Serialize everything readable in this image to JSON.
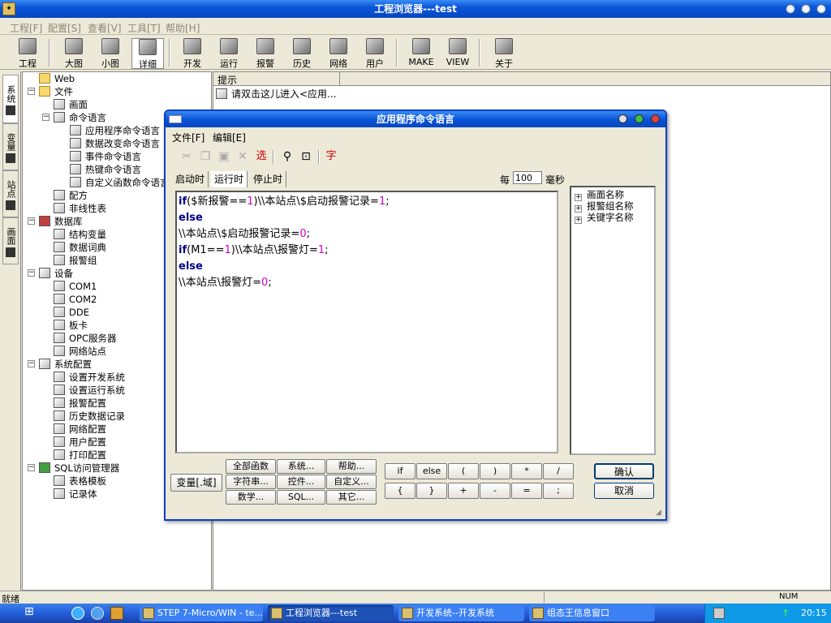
{
  "window": {
    "title": "工程浏览器---test"
  },
  "menubar": [
    "工程[F]",
    "配置[S]",
    "查看[V]",
    "工具[T]",
    "帮助[H]"
  ],
  "toolbar": [
    {
      "label": "工程",
      "icon": "project-icon"
    },
    {
      "label": "大图",
      "icon": "large-icons-icon"
    },
    {
      "label": "小图",
      "icon": "small-icons-icon"
    },
    {
      "label": "详细",
      "icon": "details-icon"
    },
    {
      "label": "开发",
      "icon": "develop-icon"
    },
    {
      "label": "运行",
      "icon": "run-icon"
    },
    {
      "label": "报警",
      "icon": "alarm-icon"
    },
    {
      "label": "历史",
      "icon": "history-icon"
    },
    {
      "label": "网络",
      "icon": "network-icon"
    },
    {
      "label": "用户",
      "icon": "user-key-icon"
    },
    {
      "label": "MAKE",
      "icon": "make-icon"
    },
    {
      "label": "VIEW",
      "icon": "view-icon"
    },
    {
      "label": "关于",
      "icon": "about-icon"
    }
  ],
  "side_tabs": [
    "系统",
    "变量",
    "站点",
    "画面"
  ],
  "tree": [
    {
      "label": "Web"
    },
    {
      "label": "文件"
    },
    {
      "label": "画面"
    },
    {
      "label": "命令语言"
    },
    {
      "label": "应用程序命令语言"
    },
    {
      "label": "数据改变命令语言"
    },
    {
      "label": "事件命令语言"
    },
    {
      "label": "热键命令语言"
    },
    {
      "label": "自定义函数命令语言"
    },
    {
      "label": "配方"
    },
    {
      "label": "非线性表"
    },
    {
      "label": "数据库"
    },
    {
      "label": "结构变量"
    },
    {
      "label": "数据词典"
    },
    {
      "label": "报警组"
    },
    {
      "label": "设备"
    },
    {
      "label": "COM1"
    },
    {
      "label": "COM2"
    },
    {
      "label": "DDE"
    },
    {
      "label": "板卡"
    },
    {
      "label": "OPC服务器"
    },
    {
      "label": "网络站点"
    },
    {
      "label": "系统配置"
    },
    {
      "label": "设置开发系统"
    },
    {
      "label": "设置运行系统"
    },
    {
      "label": "报警配置"
    },
    {
      "label": "历史数据记录"
    },
    {
      "label": "网络配置"
    },
    {
      "label": "用户配置"
    },
    {
      "label": "打印配置"
    },
    {
      "label": "SQL访问管理器"
    },
    {
      "label": "表格模板"
    },
    {
      "label": "记录体"
    }
  ],
  "right_panel": {
    "header": "提示",
    "item": "请双击这儿进入<应用..."
  },
  "dialog": {
    "title": "应用程序命令语言",
    "menu": [
      "文件[F]",
      "编辑[E]"
    ],
    "tool_select": "选",
    "tool_font": "字",
    "tabs": [
      "启动时",
      "运行时",
      "停止时"
    ],
    "every_label": "每",
    "interval": "100",
    "unit": "毫秒",
    "code_lines": [
      [
        {
          "t": "if",
          "c": "kw"
        },
        {
          "t": "($新报警=="
        },
        {
          "t": "1",
          "c": "num"
        },
        {
          "t": ")\\\\本站点\\$启动报警记录="
        },
        {
          "t": "1",
          "c": "num"
        },
        {
          "t": ";"
        }
      ],
      [
        {
          "t": "else",
          "c": "kw"
        }
      ],
      [
        {
          "t": "\\\\本站点\\$启动报警记录="
        },
        {
          "t": "0",
          "c": "num"
        },
        {
          "t": ";"
        }
      ],
      [
        {
          "t": "if",
          "c": "kw"
        },
        {
          "t": "(M1=="
        },
        {
          "t": "1",
          "c": "num"
        },
        {
          "t": ")\\\\本站点\\报警灯="
        },
        {
          "t": "1",
          "c": "num"
        },
        {
          "t": ";"
        }
      ],
      [
        {
          "t": "else",
          "c": "kw"
        }
      ],
      [
        {
          "t": "\\\\本站点\\报警灯="
        },
        {
          "t": "0",
          "c": "num"
        },
        {
          "t": ";"
        }
      ]
    ],
    "side_tree": [
      "画面名称",
      "报警组名称",
      "关键字名称"
    ],
    "var_button": "变量[.域]",
    "func_buttons": [
      "全部函数",
      "系统...",
      "帮助...",
      "字符串...",
      "控件...",
      "自定义...",
      "数学...",
      "SQL...",
      "其它..."
    ],
    "op_buttons": [
      "if",
      "else",
      "(",
      ")",
      "*",
      "/",
      "{",
      "}",
      "+",
      "-",
      "=",
      ";"
    ],
    "ok": "确认",
    "cancel": "取消"
  },
  "status": {
    "text": "就绪",
    "right": "NUM"
  },
  "taskbar": {
    "tasks": [
      "STEP 7-Micro/WIN - te...",
      "工程浏览器---test",
      "开发系统--开发系统",
      "组态王信息窗口"
    ],
    "clock": "20:15"
  },
  "colors": {
    "titlebar": "#0a55d8",
    "keyword": "#00008b",
    "number": "#cc00cc",
    "tool_red": "#cc0000"
  }
}
